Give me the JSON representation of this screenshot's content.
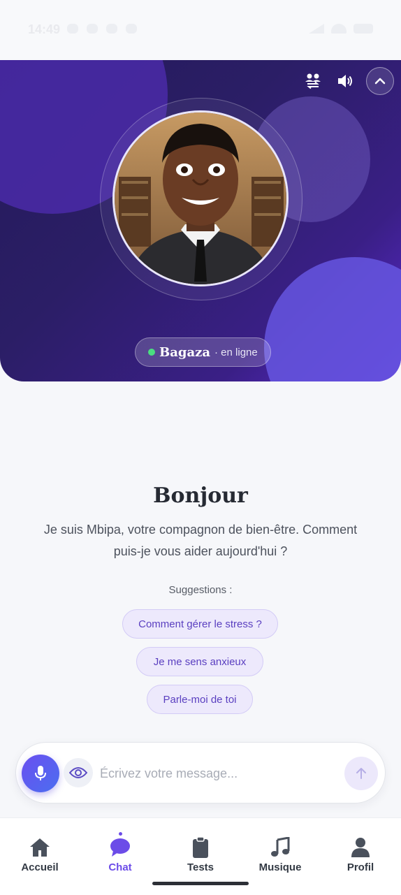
{
  "status_bar": {
    "time": "14:49"
  },
  "hero": {
    "companion_name": "Bagaza",
    "status_text": "· en ligne",
    "icons": [
      "people-swap-icon",
      "speaker-icon",
      "chevron-up-icon"
    ]
  },
  "greeting": {
    "title": "Bonjour",
    "text": "Je suis Mbipa, votre compagnon de bien-être. Comment puis-je vous aider aujourd'hui ?"
  },
  "suggestions": {
    "label": "Suggestions :",
    "items": [
      "Comment gérer le stress ?",
      "Je me sens anxieux",
      "Parle-moi de toi"
    ]
  },
  "composer": {
    "placeholder": "Écrivez votre message..."
  },
  "nav": {
    "items": [
      {
        "label": "Accueil",
        "icon": "home-icon"
      },
      {
        "label": "Chat",
        "icon": "chat-icon",
        "active": true
      },
      {
        "label": "Tests",
        "icon": "clipboard-icon"
      },
      {
        "label": "Musique",
        "icon": "music-icon"
      },
      {
        "label": "Profil",
        "icon": "profile-icon"
      }
    ]
  },
  "colors": {
    "accent": "#6c4ce8",
    "hero_dark": "#241a5a",
    "chip_bg": "#ede9fc",
    "online": "#4ade80"
  }
}
